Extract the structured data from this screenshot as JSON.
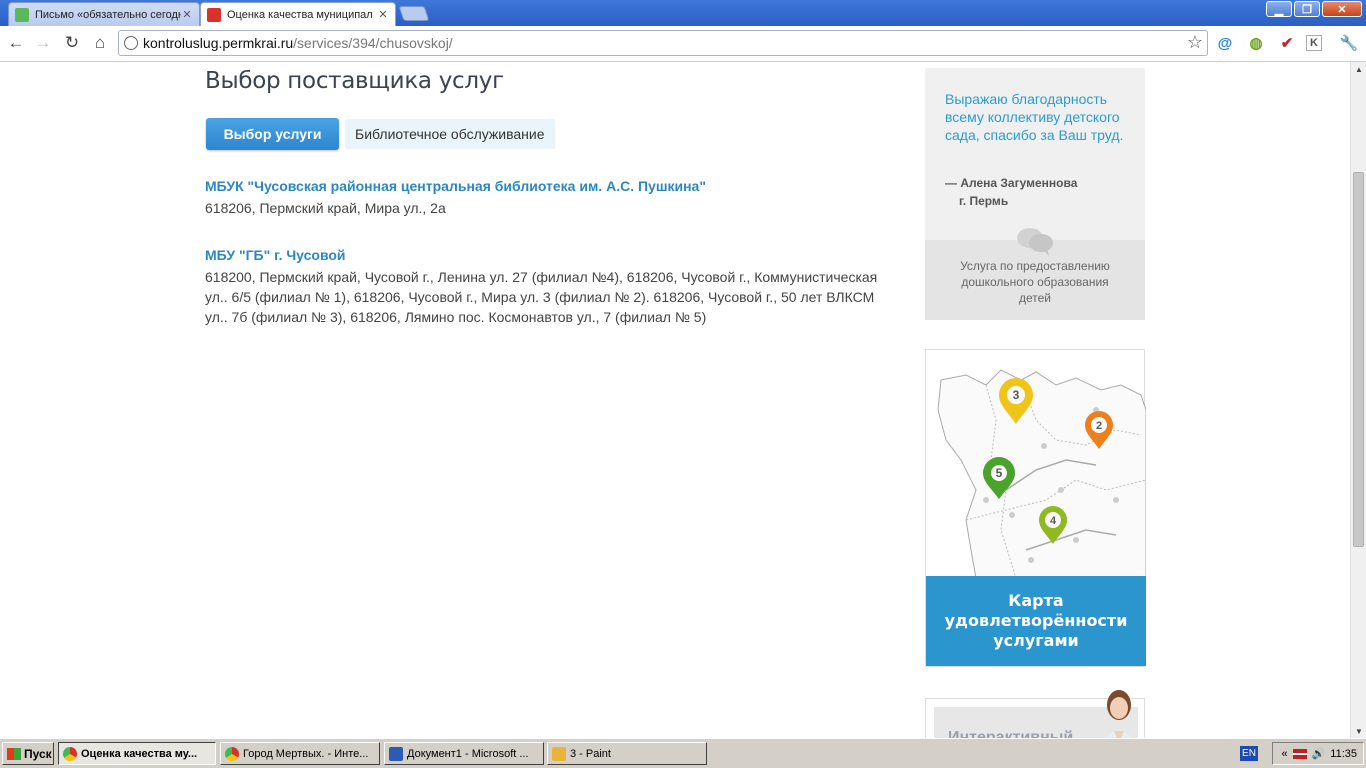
{
  "browser": {
    "tabs": [
      {
        "title": "Письмо «обязательно сегодн",
        "active": false
      },
      {
        "title": "Оценка качества муниципал",
        "active": true
      }
    ],
    "url_host": "kontroluslug.permkrai.ru",
    "url_path": "/services/394/chusovskoj/"
  },
  "page": {
    "title": "Выбор поставщика услуг",
    "select_button": "Выбор услуги",
    "selected_service": "Библиотечное обслуживание",
    "providers": [
      {
        "name": "МБУК \"Чусовская районная центральная библиотека им. А.С. Пушкина\"",
        "address": "618206, Пермский край, Мира ул., 2а"
      },
      {
        "name": "МБУ \"ГБ\" г. Чусовой",
        "address": "618200, Пермский край, Чусовой г., Ленина ул. 27 (филиал №4), 618206, Чусовой г., Коммунистическая ул.. 6/5 (филиал № 1), 618206, Чусовой г., Мира ул. 3 (филиал № 2). 618206, Чусовой г., 50 лет ВЛКСМ ул.. 7б (филиал № 3), 618206, Лямино пос. Космонавтов ул., 7 (филиал № 5)"
      }
    ]
  },
  "sidebar": {
    "review": {
      "quote": "Выражаю благодарность всему коллективу детского сада, спасибо за Ваш труд.",
      "author_line1": "— Алена Загуменнова",
      "author_line2": "г. Пермь",
      "service": "Услуга по предоставлению дошкольного образования детей"
    },
    "map": {
      "pins": [
        {
          "label": "3",
          "color": "#f0c419"
        },
        {
          "label": "2",
          "color": "#ef7f1a"
        },
        {
          "label": "5",
          "color": "#4aa32a"
        },
        {
          "label": "4",
          "color": "#8dbb1f"
        }
      ],
      "cta": "Карта удовлетворённости услугами"
    },
    "interactive": {
      "label": "Интерактивный"
    }
  },
  "taskbar": {
    "start": "Пуск",
    "tasks": [
      {
        "label": "Оценка качества му...",
        "active": true
      },
      {
        "label": "Город Мертвых. - Инте...",
        "active": false
      },
      {
        "label": "Документ1 - Microsoft ...",
        "active": false
      },
      {
        "label": "3 - Paint",
        "active": false
      }
    ],
    "lang": "EN",
    "clock": "11:35"
  }
}
